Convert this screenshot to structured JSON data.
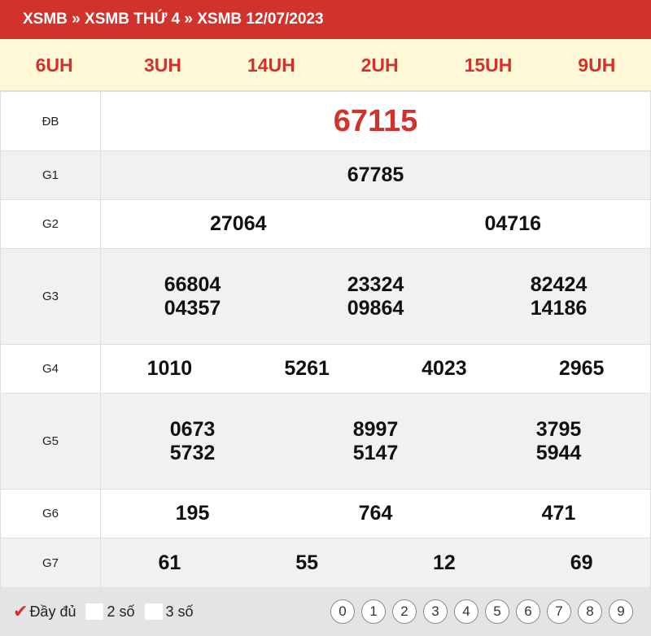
{
  "breadcrumb": "XSMB » XSMB THỨ 4 » XSMB 12/07/2023",
  "tags": [
    "6UH",
    "3UH",
    "14UH",
    "2UH",
    "15UH",
    "9UH"
  ],
  "prizes": {
    "db": {
      "label": "ĐB",
      "numbers": [
        "67115"
      ]
    },
    "g1": {
      "label": "G1",
      "numbers": [
        "67785"
      ]
    },
    "g2": {
      "label": "G2",
      "numbers": [
        "27064",
        "04716"
      ]
    },
    "g3": {
      "label": "G3",
      "numbers": [
        "66804",
        "23324",
        "82424",
        "04357",
        "09864",
        "14186"
      ]
    },
    "g4": {
      "label": "G4",
      "numbers": [
        "1010",
        "5261",
        "4023",
        "2965"
      ]
    },
    "g5": {
      "label": "G5",
      "numbers": [
        "0673",
        "8997",
        "3795",
        "5732",
        "5147",
        "5944"
      ]
    },
    "g6": {
      "label": "G6",
      "numbers": [
        "195",
        "764",
        "471"
      ]
    },
    "g7": {
      "label": "G7",
      "numbers": [
        "61",
        "55",
        "12",
        "69"
      ]
    }
  },
  "footer": {
    "options": [
      "Đầy đủ",
      "2 số",
      "3 số"
    ],
    "digits": [
      "0",
      "1",
      "2",
      "3",
      "4",
      "5",
      "6",
      "7",
      "8",
      "9"
    ]
  },
  "colors": {
    "header": "#d2322c",
    "tag_text": "#d2322c",
    "tag_bg": "#fff8d6",
    "special": "#d2322c"
  }
}
